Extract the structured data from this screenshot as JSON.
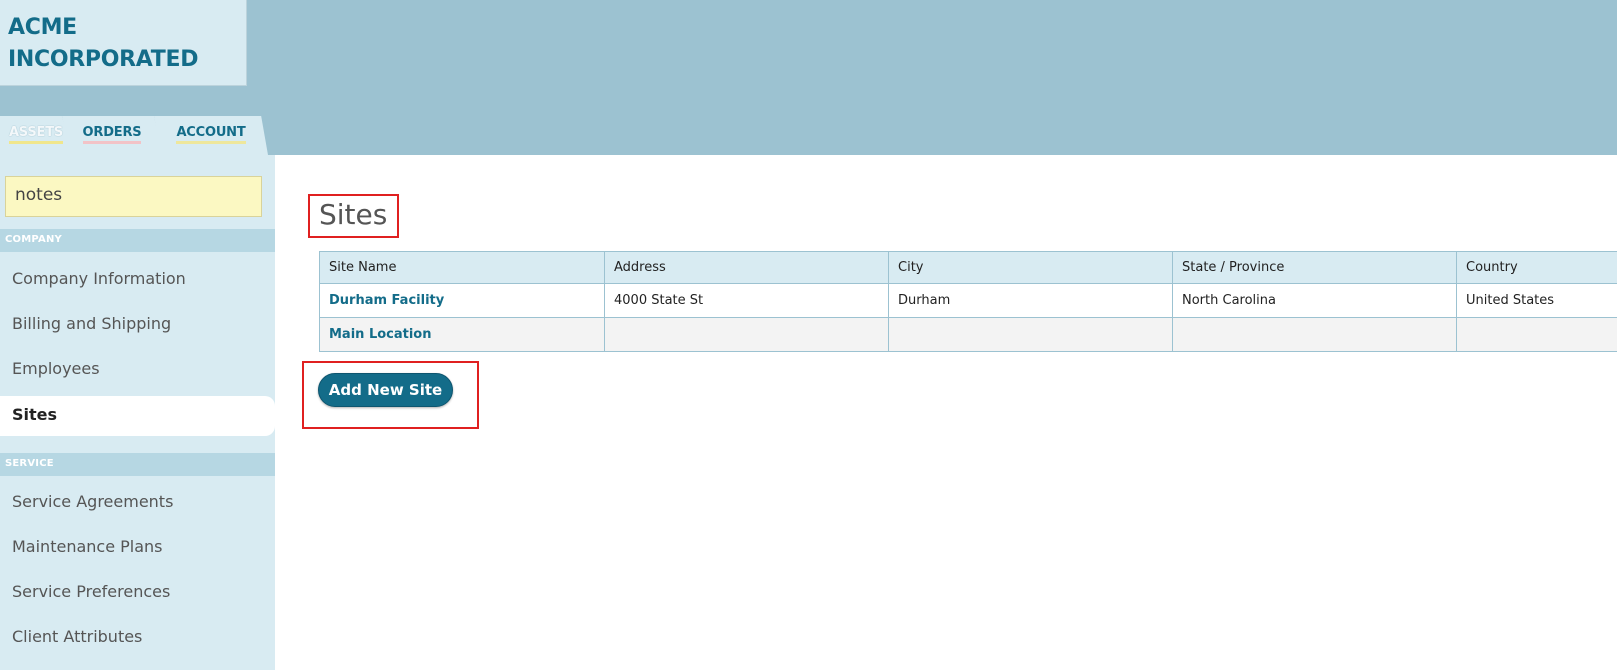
{
  "company": {
    "name_line1": "ACME",
    "name_line2": "INCORPORATED"
  },
  "tabs": [
    {
      "label": "ASSETS",
      "active": true
    },
    {
      "label": "ORDERS",
      "active": false
    },
    {
      "label": "ACCOUNT",
      "active": false
    }
  ],
  "notes_box": {
    "text": "notes"
  },
  "sidebar": {
    "company_header": "COMPANY",
    "company_items": [
      {
        "label": "Company Information"
      },
      {
        "label": "Billing and Shipping"
      },
      {
        "label": "Employees"
      },
      {
        "label": "Sites",
        "active": true
      }
    ],
    "service_header": "SERVICE",
    "service_items": [
      {
        "label": "Service Agreements"
      },
      {
        "label": "Maintenance Plans"
      },
      {
        "label": "Service Preferences"
      },
      {
        "label": "Client Attributes"
      }
    ]
  },
  "main": {
    "title": "Sites",
    "table": {
      "headers": [
        "Site Name",
        "Address",
        "City",
        "State / Province",
        "Country"
      ],
      "rows": [
        [
          "Durham Facility",
          "4000 State St",
          "Durham",
          "North Carolina",
          "United States"
        ],
        [
          "Main Location",
          "",
          "",
          "",
          ""
        ]
      ]
    },
    "add_button_label": "Add New Site"
  },
  "colors": {
    "brand": "#136c89",
    "topbar": "#9cc2d1",
    "sidebar": "#d8ebf2",
    "highlight_box": "#e02020"
  }
}
